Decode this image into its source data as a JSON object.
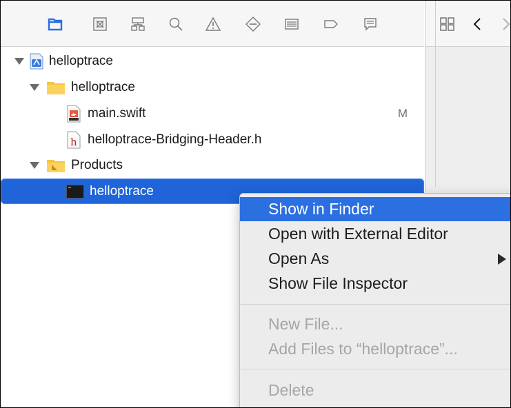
{
  "navigator_toolbar": {
    "icons": [
      "project-navigator-icon",
      "source-control-icon",
      "symbol-navigator-icon",
      "find-icon",
      "issue-icon",
      "test-icon",
      "debug-icon",
      "breakpoint-icon",
      "report-icon"
    ]
  },
  "right_toolbar": {
    "icons": [
      "related-items-icon",
      "back-icon",
      "forward-icon"
    ]
  },
  "tree": {
    "items": [
      {
        "label": "helloptrace",
        "icon": "project-icon"
      },
      {
        "label": "helloptrace",
        "icon": "folder-icon"
      },
      {
        "label": "main.swift",
        "icon": "swift-file-icon",
        "badge": "M"
      },
      {
        "label": "helloptrace-Bridging-Header.h",
        "icon": "header-file-icon"
      },
      {
        "label": "Products",
        "icon": "products-folder-icon"
      },
      {
        "label": "helloptrace",
        "icon": "executable-icon"
      }
    ]
  },
  "context_menu": {
    "items": [
      {
        "label": "Show in Finder",
        "state": "highlighted"
      },
      {
        "label": "Open with External Editor",
        "state": "enabled"
      },
      {
        "label": "Open As",
        "state": "enabled"
      },
      {
        "label": "Show File Inspector",
        "state": "enabled"
      },
      {
        "label": "New File...",
        "state": "disabled"
      },
      {
        "label": "Add Files to “helloptrace”...",
        "state": "disabled"
      },
      {
        "label": "Delete",
        "state": "disabled"
      }
    ]
  },
  "colors": {
    "selection": "#1f64d8",
    "menu_highlight": "#2b6fe0",
    "toolbar_accent": "#2a6de8",
    "folder": "#f5c443"
  }
}
